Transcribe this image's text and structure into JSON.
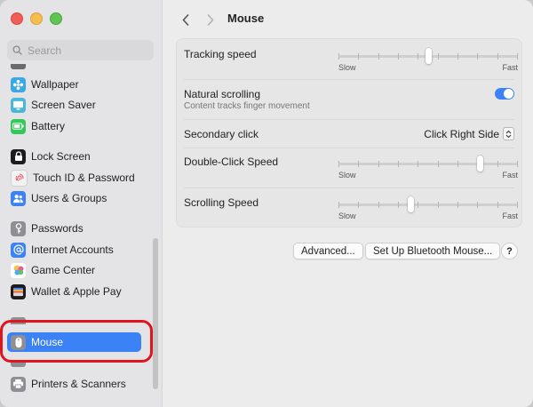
{
  "search": {
    "placeholder": "Search"
  },
  "sidebar": {
    "items": [
      {
        "label": "Wallpaper",
        "icon": "wallpaper-icon",
        "color": "#3aa7e8"
      },
      {
        "label": "Screen Saver",
        "icon": "screen-saver-icon",
        "color": "#4ab7d8"
      },
      {
        "label": "Battery",
        "icon": "battery-icon",
        "color": "#34c759"
      },
      {
        "label": "Lock Screen",
        "icon": "lock-icon",
        "color": "#1c1c1e"
      },
      {
        "label": "Touch ID & Password",
        "icon": "fingerprint-icon",
        "color": "#f2f2f2"
      },
      {
        "label": "Users & Groups",
        "icon": "users-icon",
        "color": "#3b82f6"
      },
      {
        "label": "Passwords",
        "icon": "key-icon",
        "color": "#8e8e93"
      },
      {
        "label": "Internet Accounts",
        "icon": "at-sign-icon",
        "color": "#3b82f6"
      },
      {
        "label": "Game Center",
        "icon": "game-center-icon",
        "color": "#ffffff"
      },
      {
        "label": "Wallet & Apple Pay",
        "icon": "wallet-icon",
        "color": "#1c1c1e"
      },
      {
        "label": "Mouse",
        "icon": "mouse-icon",
        "color": "#8e8e93",
        "selected": true
      },
      {
        "label": "Printers & Scanners",
        "icon": "printer-icon",
        "color": "#8e8e93"
      }
    ]
  },
  "header": {
    "title": "Mouse"
  },
  "settings": {
    "tracking_speed": {
      "label": "Tracking speed",
      "min": "Slow",
      "max": "Fast",
      "value": 0.5
    },
    "natural_scrolling": {
      "label": "Natural scrolling",
      "description": "Content tracks finger movement",
      "enabled": true
    },
    "secondary_click": {
      "label": "Secondary click",
      "value": "Click Right Side"
    },
    "double_click_speed": {
      "label": "Double-Click Speed",
      "min": "Slow",
      "max": "Fast",
      "value": 0.8
    },
    "scrolling_speed": {
      "label": "Scrolling Speed",
      "min": "Slow",
      "max": "Fast",
      "value": 0.4
    }
  },
  "buttons": {
    "advanced": "Advanced...",
    "bluetooth": "Set Up Bluetooth Mouse...",
    "help": "?"
  },
  "colors": {
    "accent": "#3b82f6",
    "highlight": "#e0141e"
  }
}
